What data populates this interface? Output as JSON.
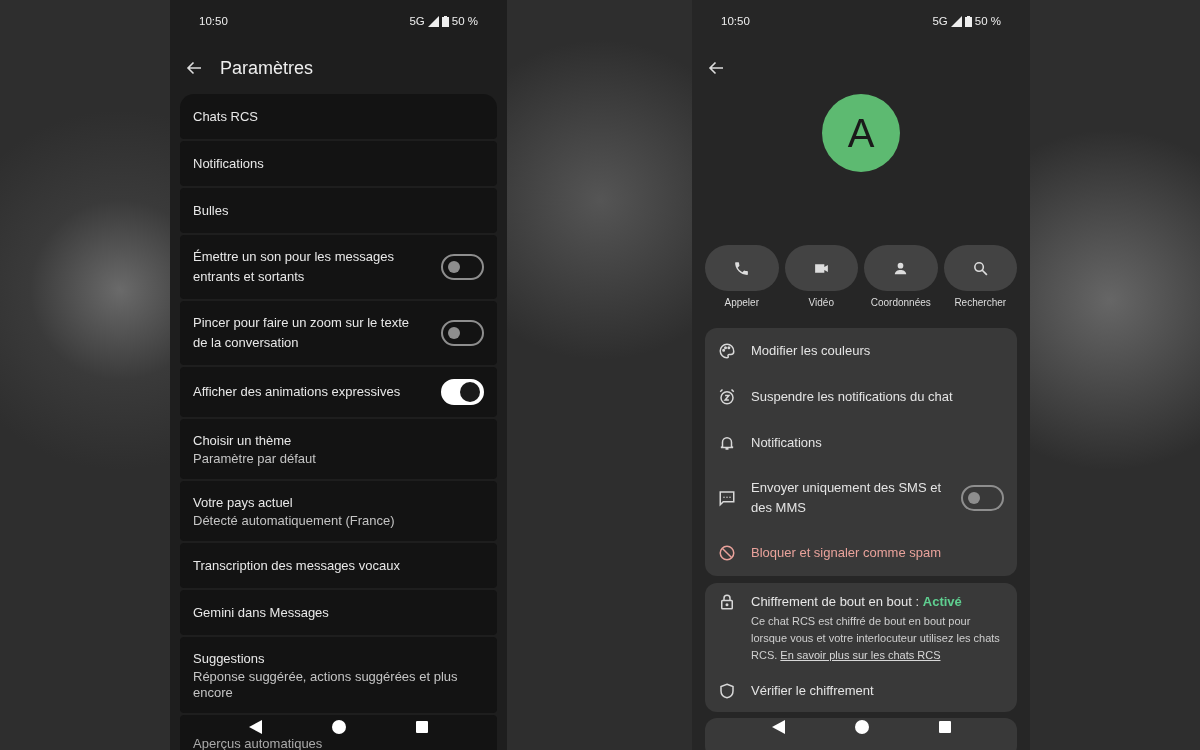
{
  "settings_screen": {
    "status_bar": {
      "time": "10:50",
      "network": "5G",
      "battery": "50 %"
    },
    "title": "Paramètres",
    "items": [
      {
        "kind": "link",
        "title": "Chats RCS"
      },
      {
        "kind": "link",
        "title": "Notifications"
      },
      {
        "kind": "link",
        "title": "Bulles"
      },
      {
        "kind": "toggle",
        "title": "Émettre un son pour les messages entrants et sortants",
        "on": false
      },
      {
        "kind": "toggle",
        "title": "Pincer pour faire un zoom sur le texte de la conversation",
        "on": false
      },
      {
        "kind": "toggle",
        "title": "Afficher des animations expressives",
        "on": true
      },
      {
        "kind": "link",
        "title": "Choisir un thème",
        "subtitle": "Paramètre par défaut"
      },
      {
        "kind": "link",
        "title": "Votre pays actuel",
        "subtitle": "Détecté automatiquement (France)"
      },
      {
        "kind": "link",
        "title": "Transcription des messages vocaux"
      },
      {
        "kind": "link",
        "title": "Gemini dans Messages"
      },
      {
        "kind": "link",
        "title": "Suggestions",
        "subtitle": "Réponse suggérée, actions suggérées et plus encore"
      },
      {
        "kind": "link",
        "title": "Aperçus automatiques"
      }
    ]
  },
  "contact_screen": {
    "status_bar": {
      "time": "10:50",
      "network": "5G",
      "battery": "50 %"
    },
    "avatar_letter": "A",
    "actions": [
      {
        "label": "Appeler"
      },
      {
        "label": "Vidéo"
      },
      {
        "label": "Coordonnées"
      },
      {
        "label": "Rechercher"
      }
    ],
    "options": [
      {
        "kind": "plain",
        "label": "Modifier les couleurs"
      },
      {
        "kind": "plain",
        "label": "Suspendre les notifications du chat"
      },
      {
        "kind": "plain",
        "label": "Notifications"
      },
      {
        "kind": "toggle",
        "label": "Envoyer uniquement des SMS et des MMS",
        "on": false
      },
      {
        "kind": "danger",
        "label": "Bloquer et signaler comme spam"
      }
    ],
    "encryption": {
      "title": "Chiffrement de bout en bout :",
      "status": "Activé",
      "description": "Ce chat RCS est chiffré de bout en bout pour lorsque vous et votre interlocuteur utilisez les chats RCS.",
      "link": "En savoir plus sur les chats RCS",
      "verify": "Vérifier le chiffrement"
    }
  }
}
